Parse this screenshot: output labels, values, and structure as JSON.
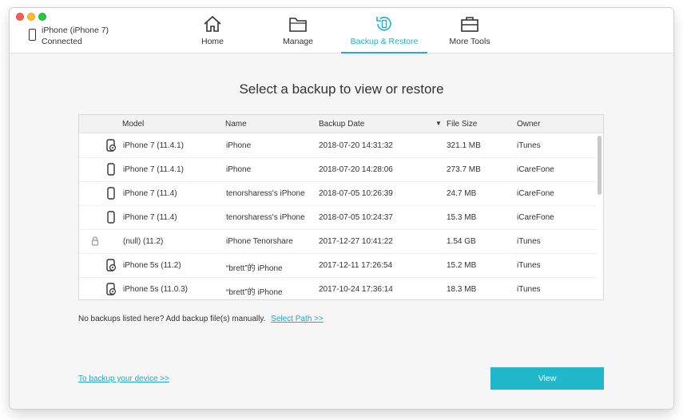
{
  "device": {
    "name": "iPhone (iPhone 7)",
    "status": "Connected"
  },
  "tabs": [
    {
      "label": "Home",
      "icon": "home-icon"
    },
    {
      "label": "Manage",
      "icon": "folder-icon"
    },
    {
      "label": "Backup & Restore",
      "icon": "backup-restore-icon",
      "active": true
    },
    {
      "label": "More Tools",
      "icon": "toolbox-icon"
    }
  ],
  "main": {
    "heading": "Select a backup to view or restore",
    "columns": {
      "model": "Model",
      "name": "Name",
      "date": "Backup Date",
      "size": "File Size",
      "owner": "Owner"
    },
    "rows": [
      {
        "model": "iPhone 7 (11.4.1)",
        "name": "iPhone",
        "date": "2018-07-20 14:31:32",
        "size": "321.1 MB",
        "owner": "iTunes"
      },
      {
        "model": "iPhone 7 (11.4.1)",
        "name": "iPhone",
        "date": "2018-07-20 14:28:06",
        "size": "273.7 MB",
        "owner": "iCareFone"
      },
      {
        "model": "iPhone 7 (11.4)",
        "name": "tenorsharess's iPhone",
        "date": "2018-07-05 10:26:39",
        "size": "24.7 MB",
        "owner": "iCareFone"
      },
      {
        "model": "iPhone 7 (11.4)",
        "name": "tenorsharess's iPhone",
        "date": "2018-07-05 10:24:37",
        "size": "15.3 MB",
        "owner": "iCareFone"
      },
      {
        "model": "(null) (11.2)",
        "name": "iPhone Tenorshare",
        "date": "2017-12-27 10:41:22",
        "size": "1.54 GB",
        "owner": "iTunes"
      },
      {
        "model": "iPhone 5s (11.2)",
        "name": "“brett”的 iPhone",
        "date": "2017-12-11 17:26:54",
        "size": "15.2 MB",
        "owner": "iTunes"
      },
      {
        "model": "iPhone 5s (11.0.3)",
        "name": "“brett”的 iPhone",
        "date": "2017-10-24 17:36:14",
        "size": "18.3 MB",
        "owner": "iTunes"
      }
    ],
    "note": "No backups listed here? Add backup file(s) manually.",
    "select_path": "Select Path >>",
    "backup_link": "To backup your device >>",
    "view_button": "View"
  },
  "colors": {
    "accent": "#22b8cc"
  }
}
